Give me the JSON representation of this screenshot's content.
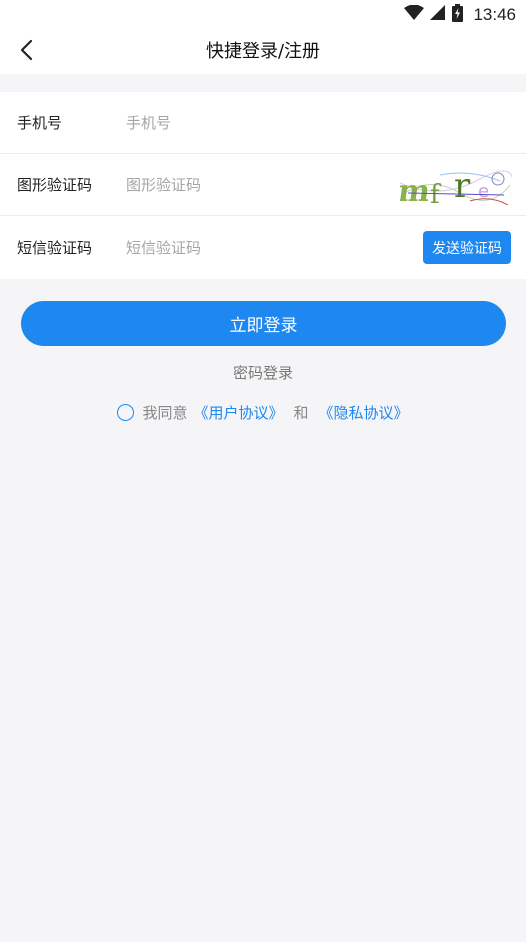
{
  "status_bar": {
    "time": "13:46",
    "icons": [
      "wifi-icon",
      "signal-icon",
      "battery-icon"
    ]
  },
  "nav": {
    "title": "快捷登录/注册",
    "back_icon": "chevron-left-icon"
  },
  "form": {
    "phone": {
      "label": "手机号",
      "placeholder": "手机号",
      "value": ""
    },
    "captcha": {
      "label": "图形验证码",
      "placeholder": "图形验证码",
      "value": ""
    },
    "sms": {
      "label": "短信验证码",
      "placeholder": "短信验证码",
      "value": "",
      "send_button_label": "发送验证码"
    }
  },
  "actions": {
    "login_label": "立即登录",
    "password_login_label": "密码登录"
  },
  "agreement": {
    "prefix": "我同意",
    "user_agreement": "《用户协议》",
    "conjunction": "和",
    "privacy_policy": "《隐私协议》",
    "checked": false
  },
  "colors": {
    "accent": "#1f87f0",
    "background": "#f5f5f7",
    "card": "#ffffff"
  }
}
